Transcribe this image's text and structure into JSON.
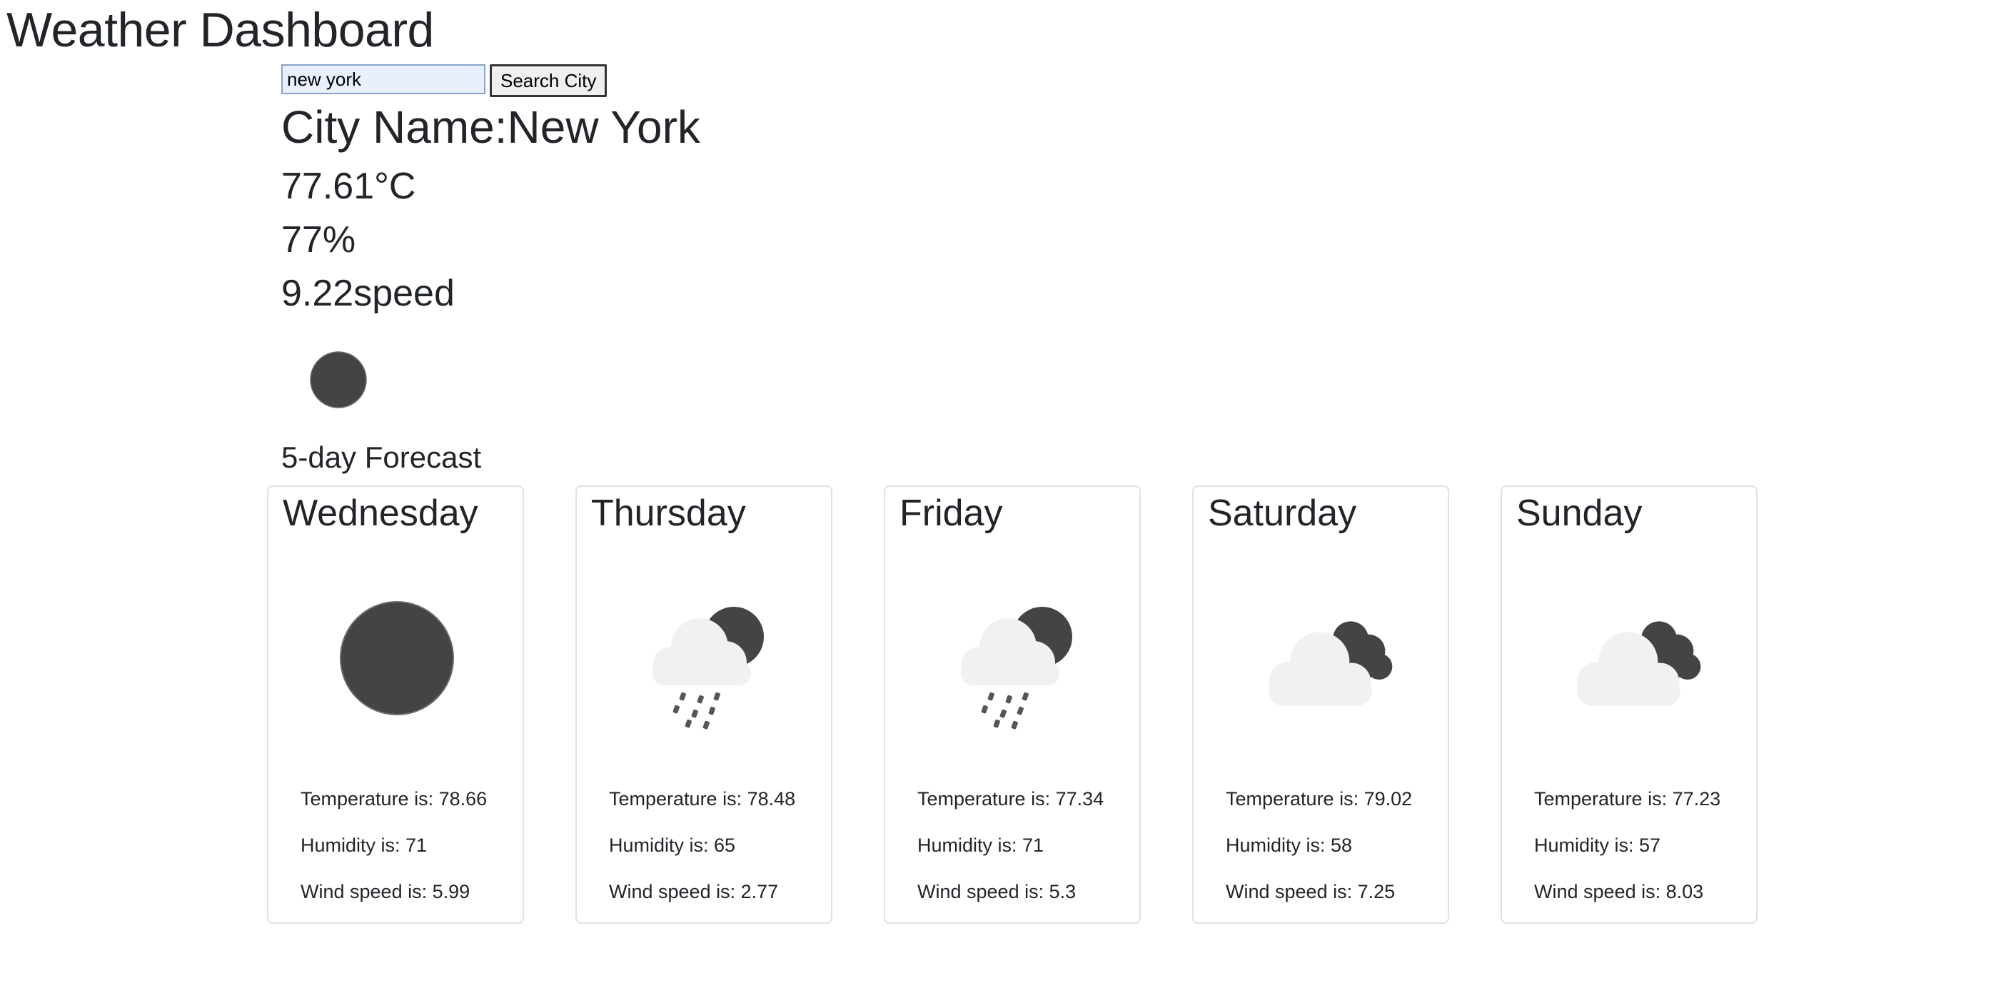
{
  "header": {
    "title": "Weather Dashboard"
  },
  "search": {
    "value": "new york",
    "button_label": "Search City"
  },
  "current": {
    "city_name": "City Name:New York",
    "temperature": "77.61°C",
    "humidity": "77%",
    "wind": "9.22speed",
    "icon": "clear-night-icon"
  },
  "forecast": {
    "title": "5-day Forecast",
    "days": [
      {
        "day": "Wednesday",
        "icon": "clear-night-icon",
        "temperature": "Temperature is: 78.66",
        "humidity": "Humidity is: 71",
        "wind": "Wind speed is: 5.99"
      },
      {
        "day": "Thursday",
        "icon": "night-rain-icon",
        "temperature": "Temperature is: 78.48",
        "humidity": "Humidity is: 65",
        "wind": "Wind speed is: 2.77"
      },
      {
        "day": "Friday",
        "icon": "night-rain-icon",
        "temperature": "Temperature is: 77.34",
        "humidity": "Humidity is: 71",
        "wind": "Wind speed is: 5.3"
      },
      {
        "day": "Saturday",
        "icon": "broken-clouds-icon",
        "temperature": "Temperature is: 79.02",
        "humidity": "Humidity is: 58",
        "wind": "Wind speed is: 7.25"
      },
      {
        "day": "Sunday",
        "icon": "broken-clouds-icon",
        "temperature": "Temperature is: 77.23",
        "humidity": "Humidity is: 57",
        "wind": "Wind speed is: 8.03"
      }
    ]
  },
  "colors": {
    "icon_dark": "#444446",
    "cloud_light": "#f1f1f0",
    "card_border": "#dee2e6",
    "text": "#212529"
  }
}
